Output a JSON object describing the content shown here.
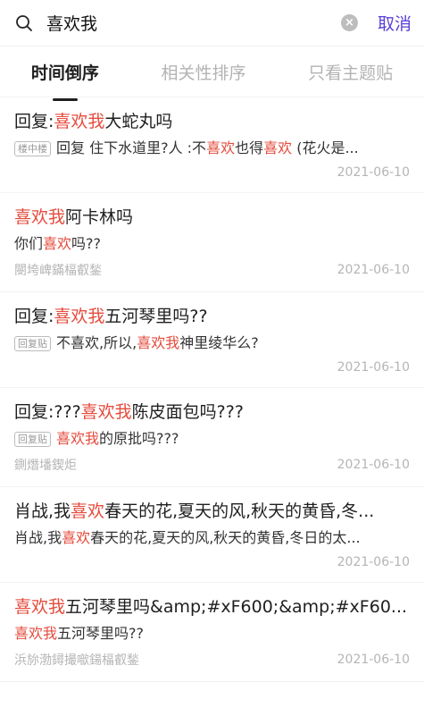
{
  "search": {
    "query": "喜欢我",
    "cancel_label": "取消"
  },
  "tabs": [
    {
      "label": "时间倒序",
      "active": true
    },
    {
      "label": "相关性排序",
      "active": false
    },
    {
      "label": "只看主题贴",
      "active": false
    }
  ],
  "colors": {
    "accent": "#5b3fd6",
    "highlight": "#e54b3c"
  },
  "results": [
    {
      "title": [
        {
          "t": "回复:"
        },
        {
          "t": "喜欢我",
          "h": true
        },
        {
          "t": "大蛇丸吗"
        }
      ],
      "badge": "楼中楼",
      "snippet": [
        {
          "t": "回复 住下水道里?人 :不"
        },
        {
          "t": "喜欢",
          "h": true
        },
        {
          "t": "也得"
        },
        {
          "t": "喜欢",
          "h": true
        },
        {
          "t": " (花火是..."
        }
      ],
      "author": "",
      "date": "2021-06-10"
    },
    {
      "title": [
        {
          "t": "喜欢我",
          "h": true
        },
        {
          "t": "阿卡林吗"
        }
      ],
      "badge": "",
      "snippet": [
        {
          "t": "你们"
        },
        {
          "t": "喜欢",
          "h": true
        },
        {
          "t": "吗??"
        }
      ],
      "author": "閿垮崥鏋楅叡鍫",
      "date": "2021-06-10"
    },
    {
      "title": [
        {
          "t": "回复:"
        },
        {
          "t": "喜欢我",
          "h": true
        },
        {
          "t": "五河琴里吗??"
        }
      ],
      "badge": "回复贴",
      "snippet": [
        {
          "t": "不喜欢,所以,"
        },
        {
          "t": "喜欢我",
          "h": true
        },
        {
          "t": "神里绫华么?"
        }
      ],
      "author": "",
      "date": "2021-06-10"
    },
    {
      "title": [
        {
          "t": "回复:???"
        },
        {
          "t": "喜欢我",
          "h": true
        },
        {
          "t": "陈皮面包吗???"
        }
      ],
      "badge": "回复贴",
      "snippet": [
        {
          "t": "喜欢我",
          "h": true
        },
        {
          "t": "的原批吗???"
        }
      ],
      "author": "鍘熸墦鍥炬",
      "date": "2021-06-10"
    },
    {
      "title": [
        {
          "t": "肖战,我"
        },
        {
          "t": "喜欢",
          "h": true
        },
        {
          "t": "春天的花,夏天的风,秋天的黄昏,冬..."
        }
      ],
      "badge": "",
      "snippet": [
        {
          "t": "肖战,我"
        },
        {
          "t": "喜欢",
          "h": true
        },
        {
          "t": "春天的花,夏天的风,秋天的黄昏,冬日的太..."
        }
      ],
      "author": "",
      "date": "2021-06-10"
    },
    {
      "title": [
        {
          "t": "喜欢我",
          "h": true
        },
        {
          "t": "五河琴里吗&amp;#xF600;&amp;#xF60..."
        }
      ],
      "badge": "",
      "snippet": [
        {
          "t": "喜欢我",
          "h": true
        },
        {
          "t": "五河琴里吗??"
        }
      ],
      "author": "浜旀渤鐞撮噷鍚楅叡鍫",
      "date": "2021-06-10"
    }
  ]
}
